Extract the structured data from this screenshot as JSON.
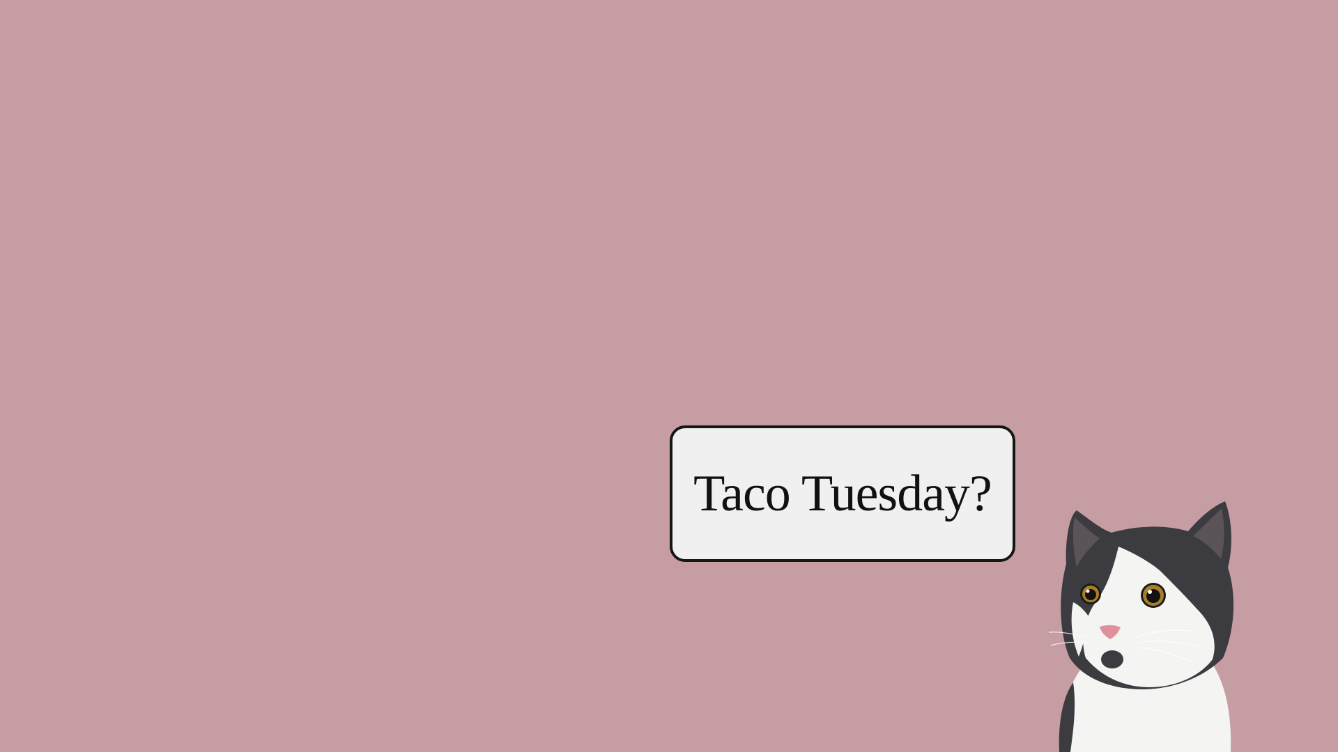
{
  "background_color": "#c69da3",
  "speech_bubble": {
    "text": "Taco Tuesday?",
    "fill_color": "#f0f0f0",
    "border_color": "#161616"
  },
  "cat": {
    "icon": "cat-photo",
    "colors": {
      "fur_dark": "#3c3b40",
      "fur_white": "#f4f4f2",
      "eye": "#a97f2c",
      "nose": "#e0909c"
    }
  }
}
